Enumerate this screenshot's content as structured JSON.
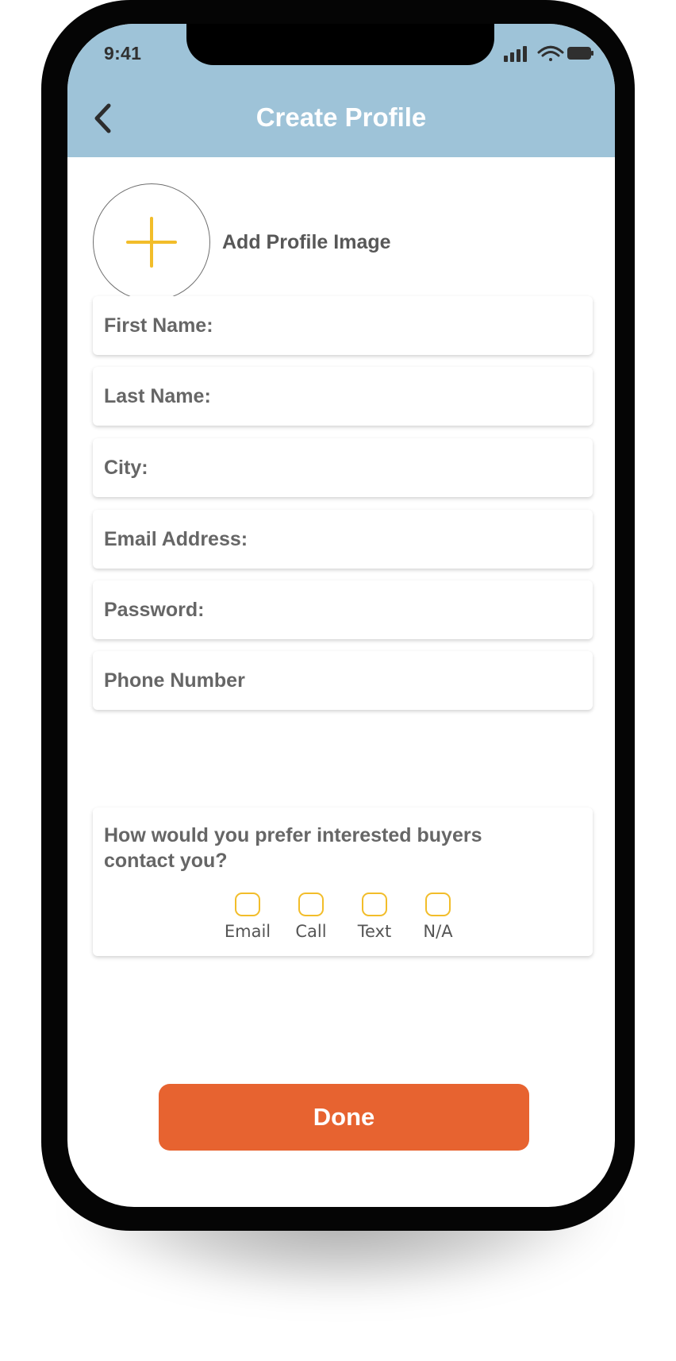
{
  "status_bar": {
    "time": "9:41"
  },
  "header": {
    "title": "Create Profile"
  },
  "profile_image": {
    "label": "Add Profile Image"
  },
  "form": {
    "first_name_label": "First Name:",
    "last_name_label": "Last Name:",
    "city_label": "City:",
    "email_label": "Email Address:",
    "password_label": "Password:",
    "phone_label": "Phone Number"
  },
  "contact_preference": {
    "question": "How would you prefer interested buyers contact you?",
    "options": [
      "Email",
      "Call",
      "Text",
      "N/A"
    ]
  },
  "actions": {
    "done_label": "Done"
  },
  "colors": {
    "header": "#9ec3d8",
    "accent": "#e76330",
    "checkbox": "#f2bd2a",
    "plus_icon": "#f2bd2a"
  },
  "icons": {
    "back": "chevron-left-icon",
    "add_image": "plus-icon",
    "signal": "cellular-signal-icon",
    "wifi": "wifi-icon",
    "battery": "battery-icon"
  }
}
